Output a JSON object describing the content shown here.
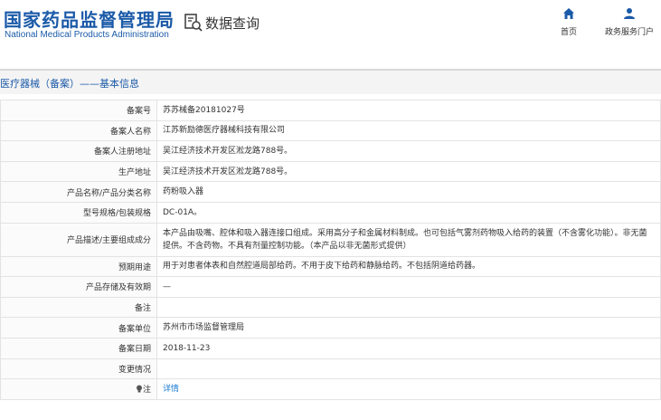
{
  "header": {
    "logo_cn": "国家药品监督管理局",
    "logo_en": "National Medical Products Administration",
    "query_label": "数据查询",
    "nav_home": "首页",
    "nav_portal": "政务服务门户"
  },
  "section_title": "医疗器械（备案）——基本信息",
  "rows": [
    {
      "label": "备案号",
      "value": "苏苏械备20181027号"
    },
    {
      "label": "备案人名称",
      "value": "江苏新励德医疗器械科技有限公司"
    },
    {
      "label": "备案人注册地址",
      "value": "吴江经济技术开发区淞龙路788号。"
    },
    {
      "label": "生产地址",
      "value": "吴江经济技术开发区淞龙路788号。"
    },
    {
      "label": "产品名称/产品分类名称",
      "value": "药粉吸入器"
    },
    {
      "label": "型号规格/包装规格",
      "value": "DC-01A。"
    },
    {
      "label": "产品描述/主要组成成分",
      "value": "本产品由吸嘴、腔体和吸入器连接口组成。采用高分子和金属材料制成。也可包括气雾剂药物吸入给药的装置（不含雾化功能）。非无菌提供。不含药物。不具有剂量控制功能。（本产品以非无菌形式提供）"
    },
    {
      "label": "预期用途",
      "value": "用于对患者体表和自然腔道局部给药。不用于皮下给药和静脉给药。不包括阴道给药器。"
    },
    {
      "label": "产品存储及有效期",
      "value": "—"
    },
    {
      "label": "备注",
      "value": ""
    },
    {
      "label": "备案单位",
      "value": "苏州市市场监督管理局"
    },
    {
      "label": "备案日期",
      "value": "2018-11-23"
    },
    {
      "label": "变更情况",
      "value": ""
    },
    {
      "label": "注",
      "value": "详情"
    }
  ],
  "colors": {
    "brand": "#1b5aa8",
    "link": "#1b7bd0"
  },
  "icons": {
    "query": "search-document-icon",
    "home": "home-icon",
    "portal": "user-icon",
    "note": "bulb-icon"
  }
}
